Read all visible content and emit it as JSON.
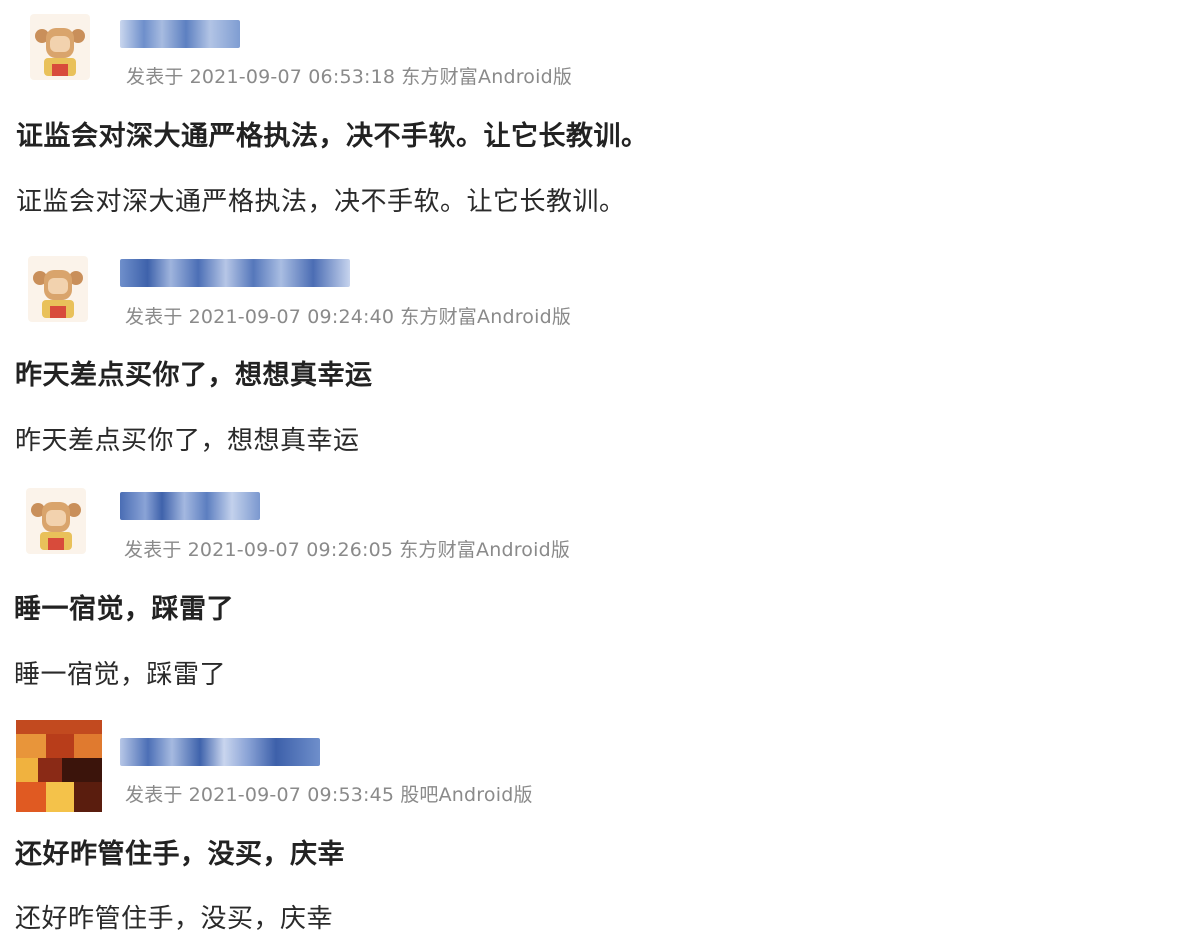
{
  "posts": [
    {
      "meta_prefix": "发表于",
      "timestamp": "2021-09-07 06:53:18",
      "source": "东方财富Android版",
      "title": "证监会对深大通严格执法，决不手软。让它长教训。",
      "body": "证监会对深大通严格执法，决不手软。让它长教训。",
      "avatar_icon": "cartoon-monkey-avatar"
    },
    {
      "meta_prefix": "发表于",
      "timestamp": "2021-09-07 09:24:40",
      "source": "东方财富Android版",
      "title": "昨天差点买你了，想想真幸运",
      "body": "昨天差点买你了，想想真幸运",
      "avatar_icon": "cartoon-monkey-avatar"
    },
    {
      "meta_prefix": "发表于",
      "timestamp": "2021-09-07 09:26:05",
      "source": "东方财富Android版",
      "title": "睡一宿觉，踩雷了",
      "body": "睡一宿觉，踩雷了",
      "avatar_icon": "cartoon-monkey-avatar"
    },
    {
      "meta_prefix": "发表于",
      "timestamp": "2021-09-07 09:53:45",
      "source": "股吧Android版",
      "title": "还好昨管住手，没买，庆幸",
      "body": "还好昨管住手，没买，庆幸",
      "avatar_icon": "photo-avatar"
    }
  ],
  "colors": {
    "username_blur": "#4a6fb5",
    "meta_text": "#8a8a8a",
    "title_text": "#222222",
    "body_text": "#2a2a2a"
  }
}
